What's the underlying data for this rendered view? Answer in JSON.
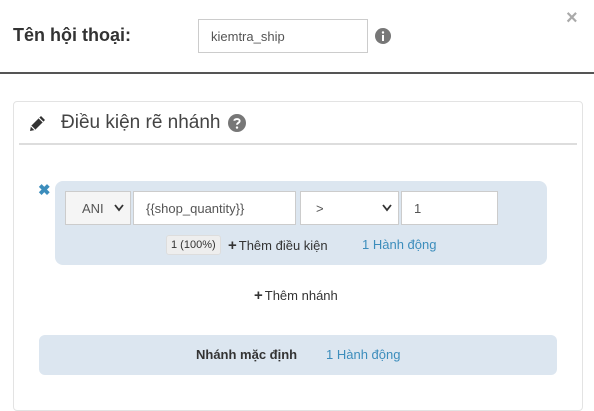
{
  "dialog": {
    "name_label": "Tên hội thoại:",
    "name_value": "kiemtra_ship",
    "close_glyph": "×"
  },
  "panel": {
    "title": "Điều kiện rẽ nhánh"
  },
  "branch": {
    "remove_glyph": "✖",
    "condition": {
      "operator": "ANI",
      "field": "{{shop_quantity}}",
      "comparison": ">",
      "value": "1"
    },
    "percent": "1 (100%)",
    "add_condition_label": "Thêm điều kiện",
    "actions_link": "1 Hành động"
  },
  "add_branch_label": "Thêm nhánh",
  "default_branch": {
    "label": "Nhánh mặc định",
    "actions_link": "1 Hành động"
  },
  "icons": {
    "info": "info-circle-icon",
    "pencil": "pencil-icon",
    "help": "question-circle-icon",
    "plus": "plus-icon"
  },
  "colors": {
    "link": "#3c8dbc",
    "branch_bg": "#dce6f0"
  }
}
